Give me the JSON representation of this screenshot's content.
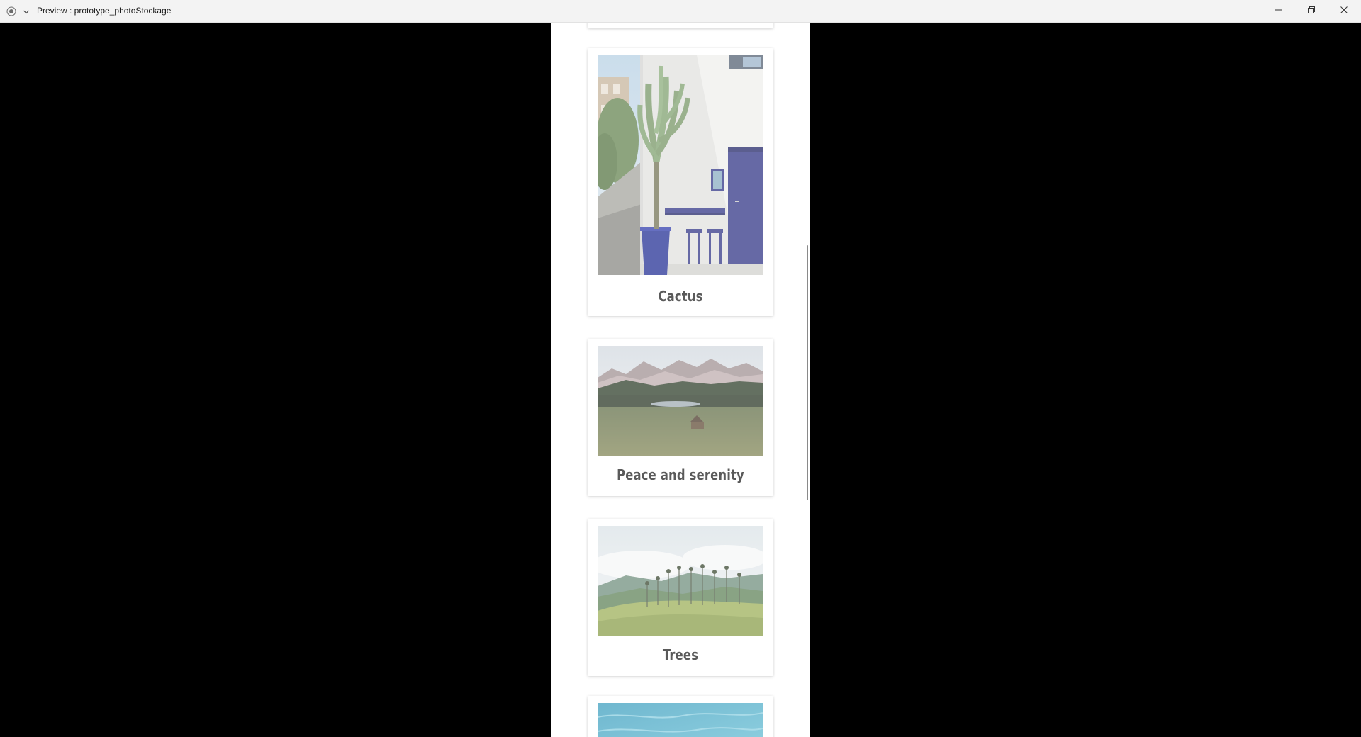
{
  "window": {
    "title": "Preview : prototype_photoStockage",
    "icons": {
      "app": "record-icon",
      "menu": "chevron-down-icon",
      "minimize": "minimize-icon",
      "maximize": "restore-icon",
      "close": "close-icon"
    }
  },
  "gallery": {
    "items": [
      {
        "caption": "Cactus"
      },
      {
        "caption": "Peace and serenity"
      },
      {
        "caption": "Trees"
      }
    ]
  }
}
